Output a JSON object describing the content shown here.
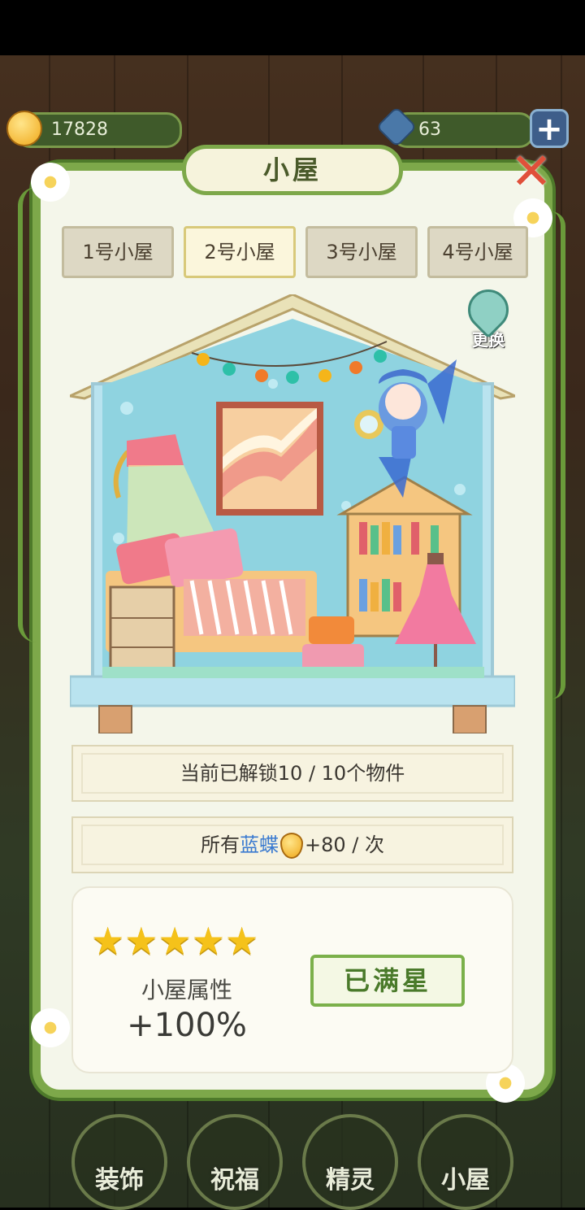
{
  "currency": {
    "coins": "17828",
    "gems": "63",
    "add_label": "+"
  },
  "panel": {
    "title": "小屋",
    "close_label": "✕"
  },
  "tabs": [
    {
      "label": "1号小屋",
      "active": false
    },
    {
      "label": "2号小屋",
      "active": true
    },
    {
      "label": "3号小屋",
      "active": false
    },
    {
      "label": "4号小屋",
      "active": false
    }
  ],
  "change_button": {
    "label": "更换"
  },
  "info": {
    "unlocked_text": "当前已解锁10 / 10个物件",
    "bonus_prefix": "所有",
    "bonus_highlight": "蓝蝶",
    "bonus_suffix": "+80 / 次"
  },
  "stars": {
    "count": 5,
    "max": 5,
    "attr_label": "小屋属性",
    "attr_value": "+100%",
    "max_button": "已满星"
  },
  "bottom_nav": [
    {
      "label": "装饰"
    },
    {
      "label": "祝福"
    },
    {
      "label": "精灵"
    },
    {
      "label": "小屋"
    }
  ],
  "colors": {
    "panel_border": "#7da84a",
    "panel_bg": "#f4f6ea",
    "star": "#f5c21a",
    "highlight_blue": "#3a7ad0"
  }
}
